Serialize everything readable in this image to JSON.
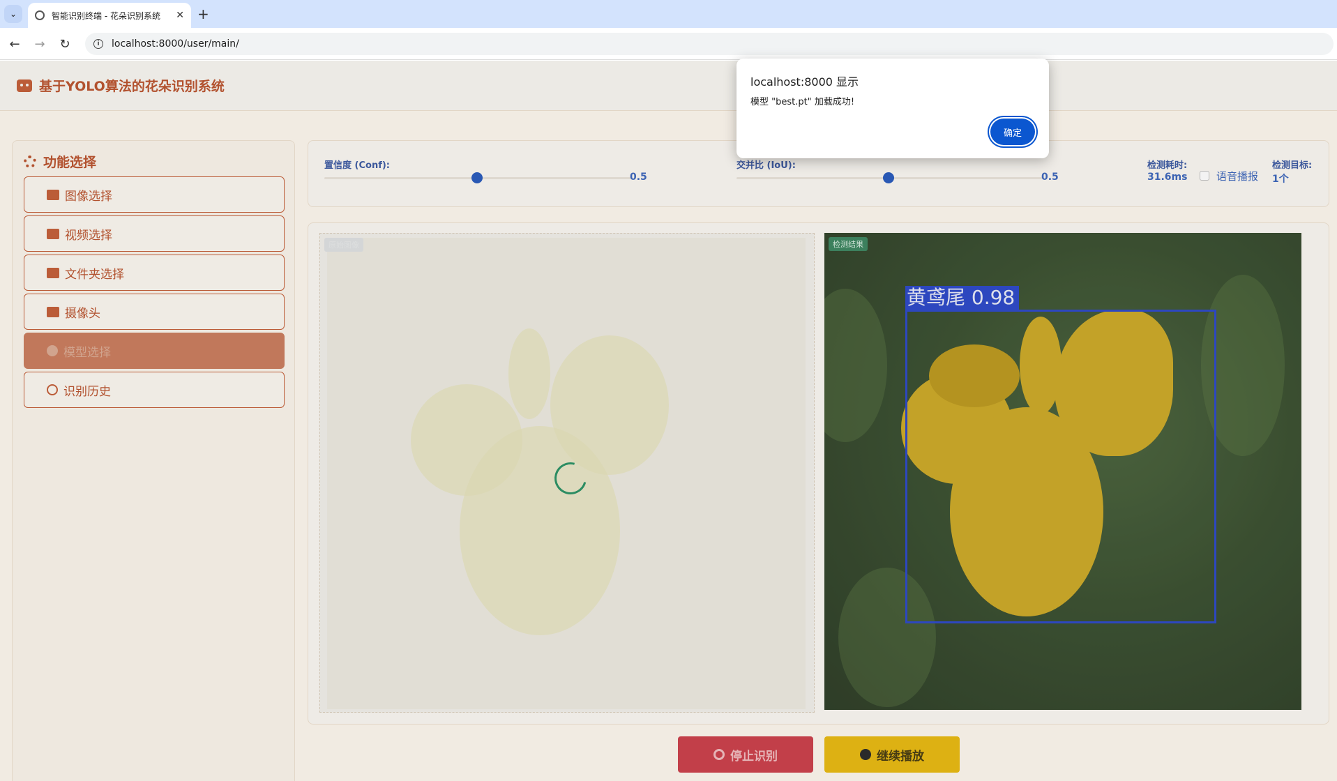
{
  "browser": {
    "tab_title": "智能识别终端 - 花朵识别系统",
    "url": "localhost:8000/user/main/"
  },
  "app": {
    "title": "基于YOLO算法的花朵识别系统"
  },
  "sidebar": {
    "title": "功能选择",
    "items": [
      {
        "label": "图像选择",
        "icon": "image-icon"
      },
      {
        "label": "视频选择",
        "icon": "video-camera-icon"
      },
      {
        "label": "文件夹选择",
        "icon": "folder-icon"
      },
      {
        "label": "摄像头",
        "icon": "camera-icon"
      },
      {
        "label": "模型选择",
        "icon": "brain-icon",
        "active": true
      },
      {
        "label": "识别历史",
        "icon": "history-icon"
      }
    ]
  },
  "controls": {
    "conf_label": "置信度 (Conf):",
    "conf_value": "0.5",
    "iou_label": "交并比 (IoU):",
    "iou_value": "0.5",
    "time_label": "检测耗时:",
    "time_value": "31.6ms",
    "voice_label": "语音播报",
    "target_label": "检测目标:",
    "target_value": "1个"
  },
  "viewer": {
    "original_tag": "原始图像",
    "result_tag": "检测结果",
    "detection_label": "黄鸢尾 0.98"
  },
  "actions": {
    "stop_label": "停止识别",
    "resume_label": "继续播放"
  },
  "dialog": {
    "title": "localhost:8000 显示",
    "message": "模型 \"best.pt\" 加载成功!",
    "ok_label": "确定"
  },
  "colors": {
    "accent": "#b5471f",
    "primary_blue": "#0b57d0",
    "stop_red": "#c8333e",
    "play_yellow": "#e6b400"
  }
}
